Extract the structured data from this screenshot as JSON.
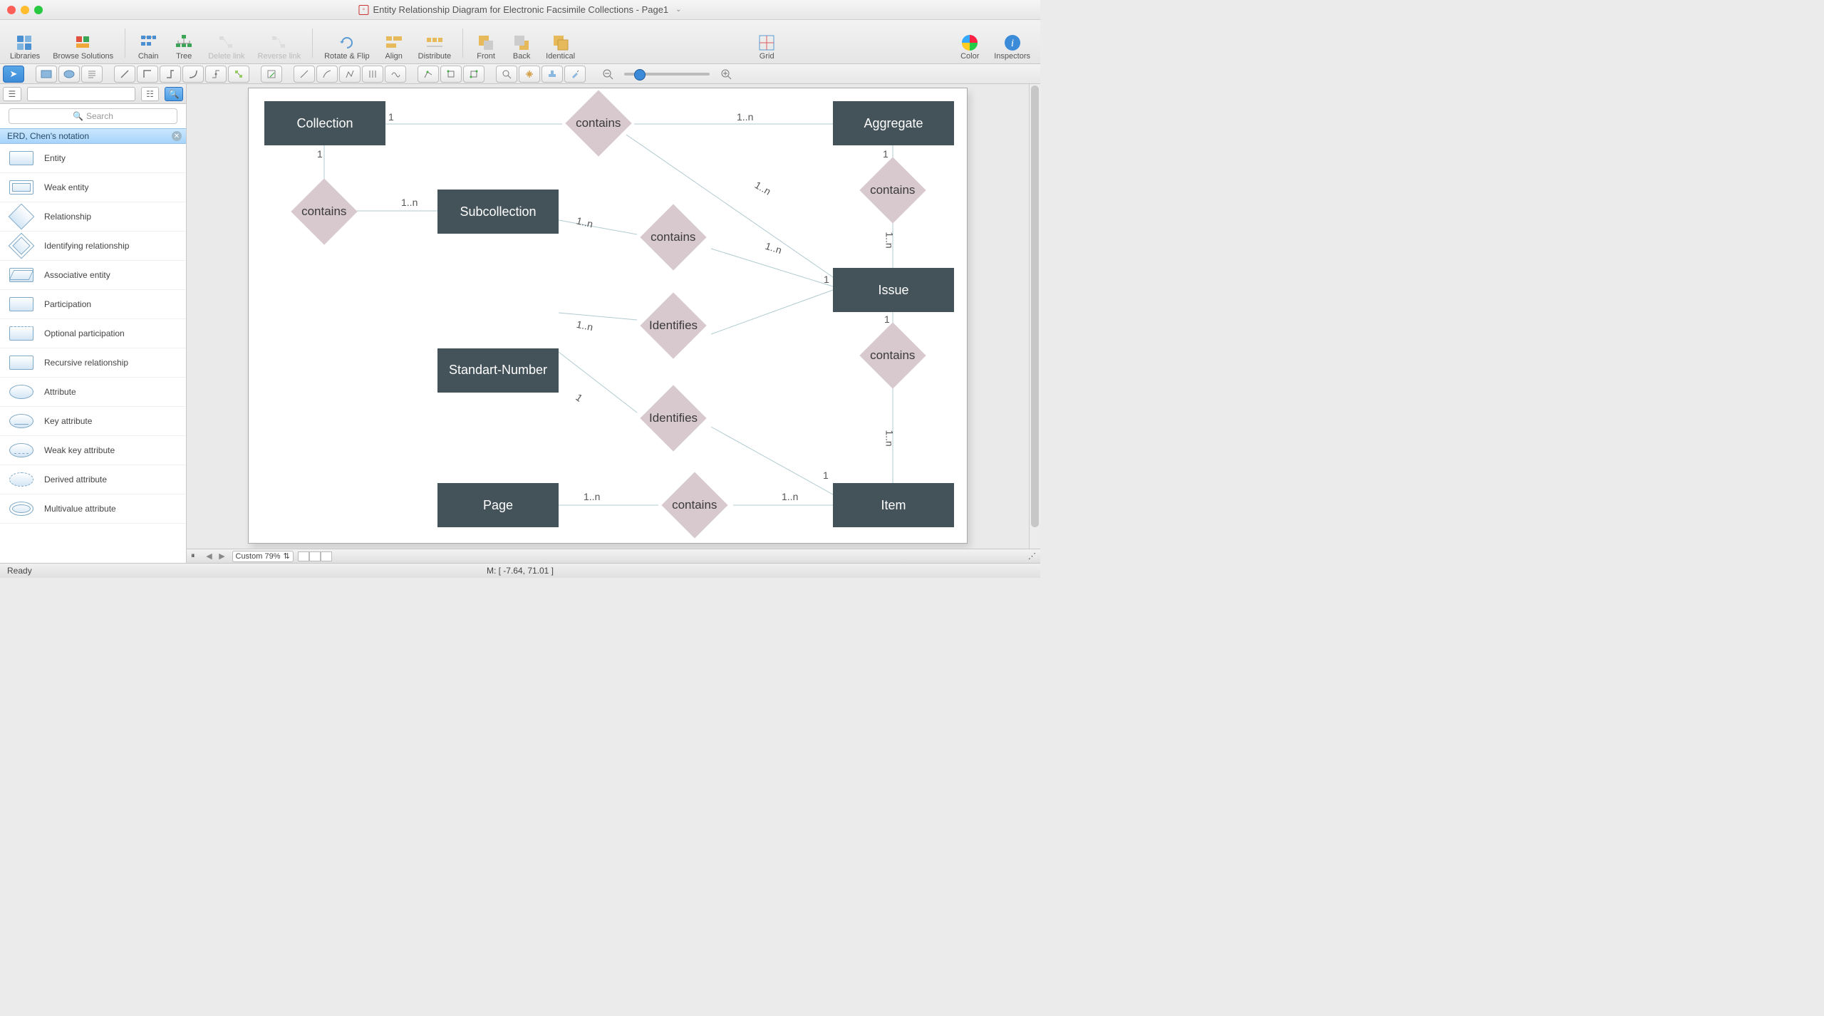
{
  "window": {
    "title": "Entity Relationship Diagram for Electronic Facsimile Collections - Page1"
  },
  "toolbar": {
    "libraries": "Libraries",
    "browse": "Browse Solutions",
    "chain": "Chain",
    "tree": "Tree",
    "delete_link": "Delete link",
    "reverse_link": "Reverse link",
    "rotate_flip": "Rotate & Flip",
    "align": "Align",
    "distribute": "Distribute",
    "front": "Front",
    "back": "Back",
    "identical": "Identical",
    "grid": "Grid",
    "color": "Color",
    "inspectors": "Inspectors"
  },
  "sidebar": {
    "search_placeholder": "Search",
    "section": "ERD, Chen's notation",
    "items": [
      "Entity",
      "Weak entity",
      "Relationship",
      "Identifying relationship",
      "Associative entity",
      "Participation",
      "Optional participation",
      "Recursive relationship",
      "Attribute",
      "Key attribute",
      "Weak key attribute",
      "Derived attribute",
      "Multivalue attribute"
    ]
  },
  "diagram": {
    "entities": {
      "collection": "Collection",
      "aggregate": "Aggregate",
      "subcollection": "Subcollection",
      "issue": "Issue",
      "standart_number": "Standart-Number",
      "page": "Page",
      "item": "Item"
    },
    "relationships": {
      "contains1": "contains",
      "contains2": "contains",
      "contains3": "contains",
      "contains4": "contains",
      "contains5": "contains",
      "contains6": "contains",
      "identifies1": "Identifies",
      "identifies2": "Identifies"
    },
    "cardinality": {
      "c1": "1",
      "c2": "1..n",
      "c3": "1",
      "c4": "1",
      "c5": "1..n",
      "c6": "1..n",
      "c7": "1..n",
      "c8": "1..n",
      "c9": "1",
      "c10": "1..n",
      "c11": "1",
      "c12": "1..n",
      "c13": "1",
      "c14": "1..n",
      "c15": "1..n",
      "c16": "1..n"
    }
  },
  "bottombar": {
    "zoom_label": "Custom 79%"
  },
  "status": {
    "ready": "Ready",
    "mouse": "M: [ -7.64, 71.01 ]"
  }
}
